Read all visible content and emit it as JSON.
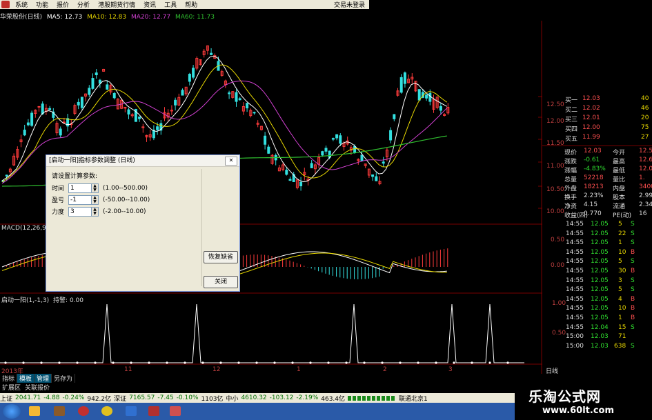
{
  "menu": {
    "items": [
      "系统",
      "功能",
      "报价",
      "分析",
      "港股期货行情",
      "资讯",
      "工具",
      "帮助"
    ],
    "login": "交易未登录"
  },
  "indicator_line": {
    "stock": "华荣股份(日线)",
    "ma5": "MA5: 12.73",
    "ma10": "MA10: 12.83",
    "ma20": "MA20: 12.77",
    "ma60": "MA60: 11.73"
  },
  "colors": {
    "up": "#ff3b3b",
    "down": "#33e0e0",
    "ma5": "#ffffff",
    "ma10": "#e8d800",
    "ma20": "#d040d0",
    "ma60": "#30c030",
    "grid": "#7a0000"
  },
  "price_axis": [
    "12.50",
    "12.00",
    "11.50",
    "11.00",
    "10.50",
    "10.00"
  ],
  "macd": {
    "label": "MACD(12,26,9)",
    "axis": [
      "0.50",
      "0.00"
    ]
  },
  "custom_indicator": {
    "label": "启动一阳(1,-1,3)",
    "value": "持警: 0.00",
    "axis": [
      "1.00",
      "0.50"
    ]
  },
  "time_axis": {
    "year": "2013年",
    "months": [
      "11",
      "12",
      "1",
      "2",
      "3"
    ],
    "period": "日线"
  },
  "dialog": {
    "title": "[启动一阳]指标参数调整 (日线)",
    "prompt": "请设置计算参数:",
    "params": [
      {
        "label": "时间",
        "value": "1",
        "range": "(1.00--500.00)"
      },
      {
        "label": "盈亏",
        "value": "-1",
        "range": "(-50.00--10.00)"
      },
      {
        "label": "力度",
        "value": "3",
        "range": "(-2.00--10.00)"
      }
    ],
    "restore_button": "恢复缺省",
    "close_button": "关闭"
  },
  "quote": {
    "bids": [
      {
        "label": "买一",
        "price": "12.03",
        "vol": "40"
      },
      {
        "label": "买二",
        "price": "12.02",
        "vol": "46"
      },
      {
        "label": "买三",
        "price": "12.01",
        "vol": "20"
      },
      {
        "label": "买四",
        "price": "12.00",
        "vol": "75"
      },
      {
        "label": "买五",
        "price": "11.99",
        "vol": "27"
      }
    ],
    "stats": [
      {
        "k1": "现价",
        "v1": "12.03",
        "k2": "今开",
        "v2": "12.5"
      },
      {
        "k1": "涨跌",
        "v1": "-0.61",
        "k2": "最高",
        "v2": "12.6"
      },
      {
        "k1": "涨幅",
        "v1": "-4.83%",
        "k2": "最低",
        "v2": "12.0"
      },
      {
        "k1": "总量",
        "v1": "52218",
        "k2": "量比",
        "v2": "1."
      },
      {
        "k1": "外盘",
        "v1": "18213",
        "k2": "内盘",
        "v2": "3400"
      },
      {
        "k1": "换手",
        "v1": "2.23%",
        "k2": "股本",
        "v2": "2.99"
      },
      {
        "k1": "净资",
        "v1": "4.15",
        "k2": "流通",
        "v2": "2.34"
      },
      {
        "k1": "收益(四)",
        "v1": "0.770",
        "k2": "PE(动)",
        "v2": "16"
      }
    ],
    "ticks": [
      {
        "t": "14:55",
        "p": "12.05",
        "v": "5",
        "s": "S"
      },
      {
        "t": "14:55",
        "p": "12.05",
        "v": "22",
        "s": "S"
      },
      {
        "t": "14:55",
        "p": "12.05",
        "v": "1",
        "s": "S"
      },
      {
        "t": "14:55",
        "p": "12.05",
        "v": "10",
        "s": "B"
      },
      {
        "t": "14:55",
        "p": "12.05",
        "v": "5",
        "s": "S"
      },
      {
        "t": "14:55",
        "p": "12.05",
        "v": "30",
        "s": "B"
      },
      {
        "t": "14:55",
        "p": "12.05",
        "v": "3",
        "s": "S"
      },
      {
        "t": "14:55",
        "p": "12.05",
        "v": "5",
        "s": "S"
      },
      {
        "t": "14:55",
        "p": "12.05",
        "v": "4",
        "s": "B"
      },
      {
        "t": "14:55",
        "p": "12.05",
        "v": "10",
        "s": "B"
      },
      {
        "t": "14:55",
        "p": "12.05",
        "v": "1",
        "s": "B"
      },
      {
        "t": "14:55",
        "p": "12.04",
        "v": "15",
        "s": "S"
      },
      {
        "t": "15:00",
        "p": "12.03",
        "v": "71",
        "s": ""
      },
      {
        "t": "15:00",
        "p": "12.03",
        "v": "638",
        "s": "S"
      }
    ]
  },
  "bottom_tabs": [
    "指标",
    "模板",
    "管理",
    "另存为"
  ],
  "bottom_tabs2": [
    "扩展区",
    "关联报价"
  ],
  "status": {
    "sh_label": "上证",
    "sh_val": "2041.71",
    "sh_chg": "-4.88",
    "sh_pct": "-0.24%",
    "sh_amt": "942.2亿",
    "sz_label": "深证",
    "sz_val": "7165.57",
    "sz_chg": "-7.45",
    "sz_pct": "-0.10%",
    "sz_amt": "1103亿",
    "zx_label": "中小",
    "zx_val": "4610.32",
    "zx_chg": "-103.12",
    "zx_pct": "-2.19%",
    "zx_amt": "463.4亿",
    "conn": "联通北京1"
  },
  "brand": {
    "name": "乐淘公式网",
    "url": "www.60lt.com"
  }
}
